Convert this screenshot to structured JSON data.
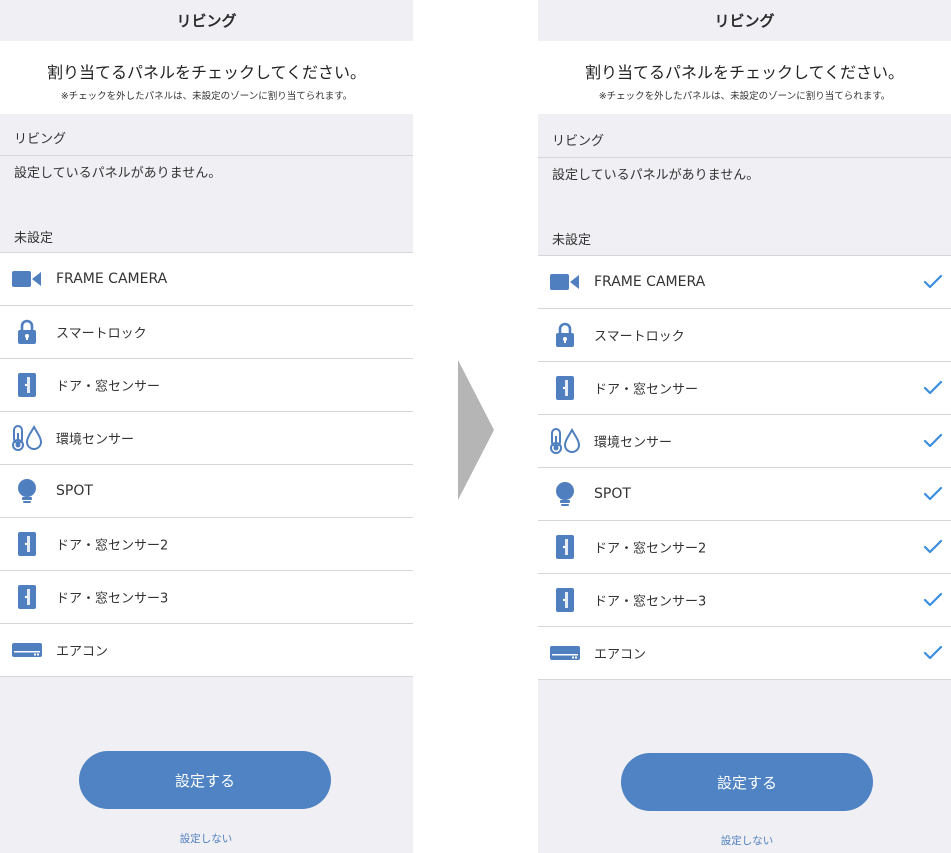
{
  "colors": {
    "icon_blue": "#4f7fbf",
    "check_blue": "#3b8de0",
    "button_blue": "#4f83c3",
    "background": "#efeff4",
    "arrow_gray": "#b5b5b5"
  },
  "screens": [
    {
      "title": "リビング",
      "instruction": "割り当てるパネルをチェックしてください。",
      "note": "※チェックを外したパネルは、未設定のゾーンに割り当てられます。",
      "zone_name": "リビング",
      "empty_message": "設定しているパネルがありません。",
      "unassigned_header": "未設定",
      "items": [
        {
          "label": "FRAME CAMERA",
          "icon": "camera-icon",
          "checked": false
        },
        {
          "label": "スマートロック",
          "icon": "lock-icon",
          "checked": false
        },
        {
          "label": "ドア・窓センサー",
          "icon": "door-sensor-icon",
          "checked": false
        },
        {
          "label": "環境センサー",
          "icon": "environment-sensor-icon",
          "checked": false
        },
        {
          "label": "SPOT",
          "icon": "bulb-icon",
          "checked": false
        },
        {
          "label": "ドア・窓センサー2",
          "icon": "door-sensor-icon",
          "checked": false
        },
        {
          "label": "ドア・窓センサー3",
          "icon": "door-sensor-icon",
          "checked": false
        },
        {
          "label": "エアコン",
          "icon": "aircon-icon",
          "checked": false
        }
      ],
      "primary_button": "設定する",
      "secondary_link": "設定しない"
    },
    {
      "title": "リビング",
      "instruction": "割り当てるパネルをチェックしてください。",
      "note": "※チェックを外したパネルは、未設定のゾーンに割り当てられます。",
      "zone_name": "リビング",
      "empty_message": "設定しているパネルがありません。",
      "unassigned_header": "未設定",
      "items": [
        {
          "label": "FRAME CAMERA",
          "icon": "camera-icon",
          "checked": true
        },
        {
          "label": "スマートロック",
          "icon": "lock-icon",
          "checked": false
        },
        {
          "label": "ドア・窓センサー",
          "icon": "door-sensor-icon",
          "checked": true
        },
        {
          "label": "環境センサー",
          "icon": "environment-sensor-icon",
          "checked": true
        },
        {
          "label": "SPOT",
          "icon": "bulb-icon",
          "checked": true
        },
        {
          "label": "ドア・窓センサー2",
          "icon": "door-sensor-icon",
          "checked": true
        },
        {
          "label": "ドア・窓センサー3",
          "icon": "door-sensor-icon",
          "checked": true
        },
        {
          "label": "エアコン",
          "icon": "aircon-icon",
          "checked": true
        }
      ],
      "primary_button": "設定する",
      "secondary_link": "設定しない"
    }
  ],
  "transition_arrow": "arrow-right-icon"
}
